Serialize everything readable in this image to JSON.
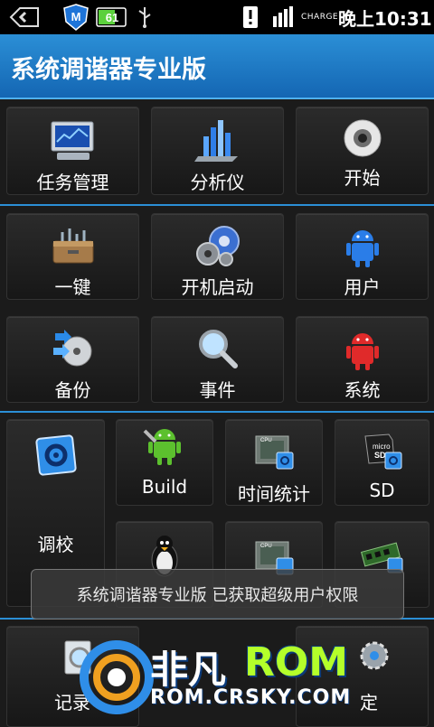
{
  "status_bar": {
    "battery_level": "61",
    "charge_label": "CHARGE",
    "time": "晚上10:31"
  },
  "app": {
    "title": "系统调谐器专业版"
  },
  "tiles": {
    "task_manager": "任务管理",
    "analyzer": "分析仪",
    "start": "开始",
    "one_key": "一键",
    "boot_startup": "开机启动",
    "user": "用户",
    "backup": "备份",
    "events": "事件",
    "system": "系统",
    "tune": "调校",
    "build": "Build",
    "time_stats": "时间统计",
    "sd": "SD",
    "record": "记录",
    "settings_partial": "定"
  },
  "toast": {
    "message": "系统调谐器专业版 已获取超级用户权限"
  },
  "watermark": {
    "brand_cn": "非凡",
    "brand_en": "ROM",
    "url": "ROM.CRSKY.COM"
  },
  "colors": {
    "title_bar": "#1a76c4",
    "separator": "#2b8fd6",
    "tile_bg": "#242424"
  }
}
